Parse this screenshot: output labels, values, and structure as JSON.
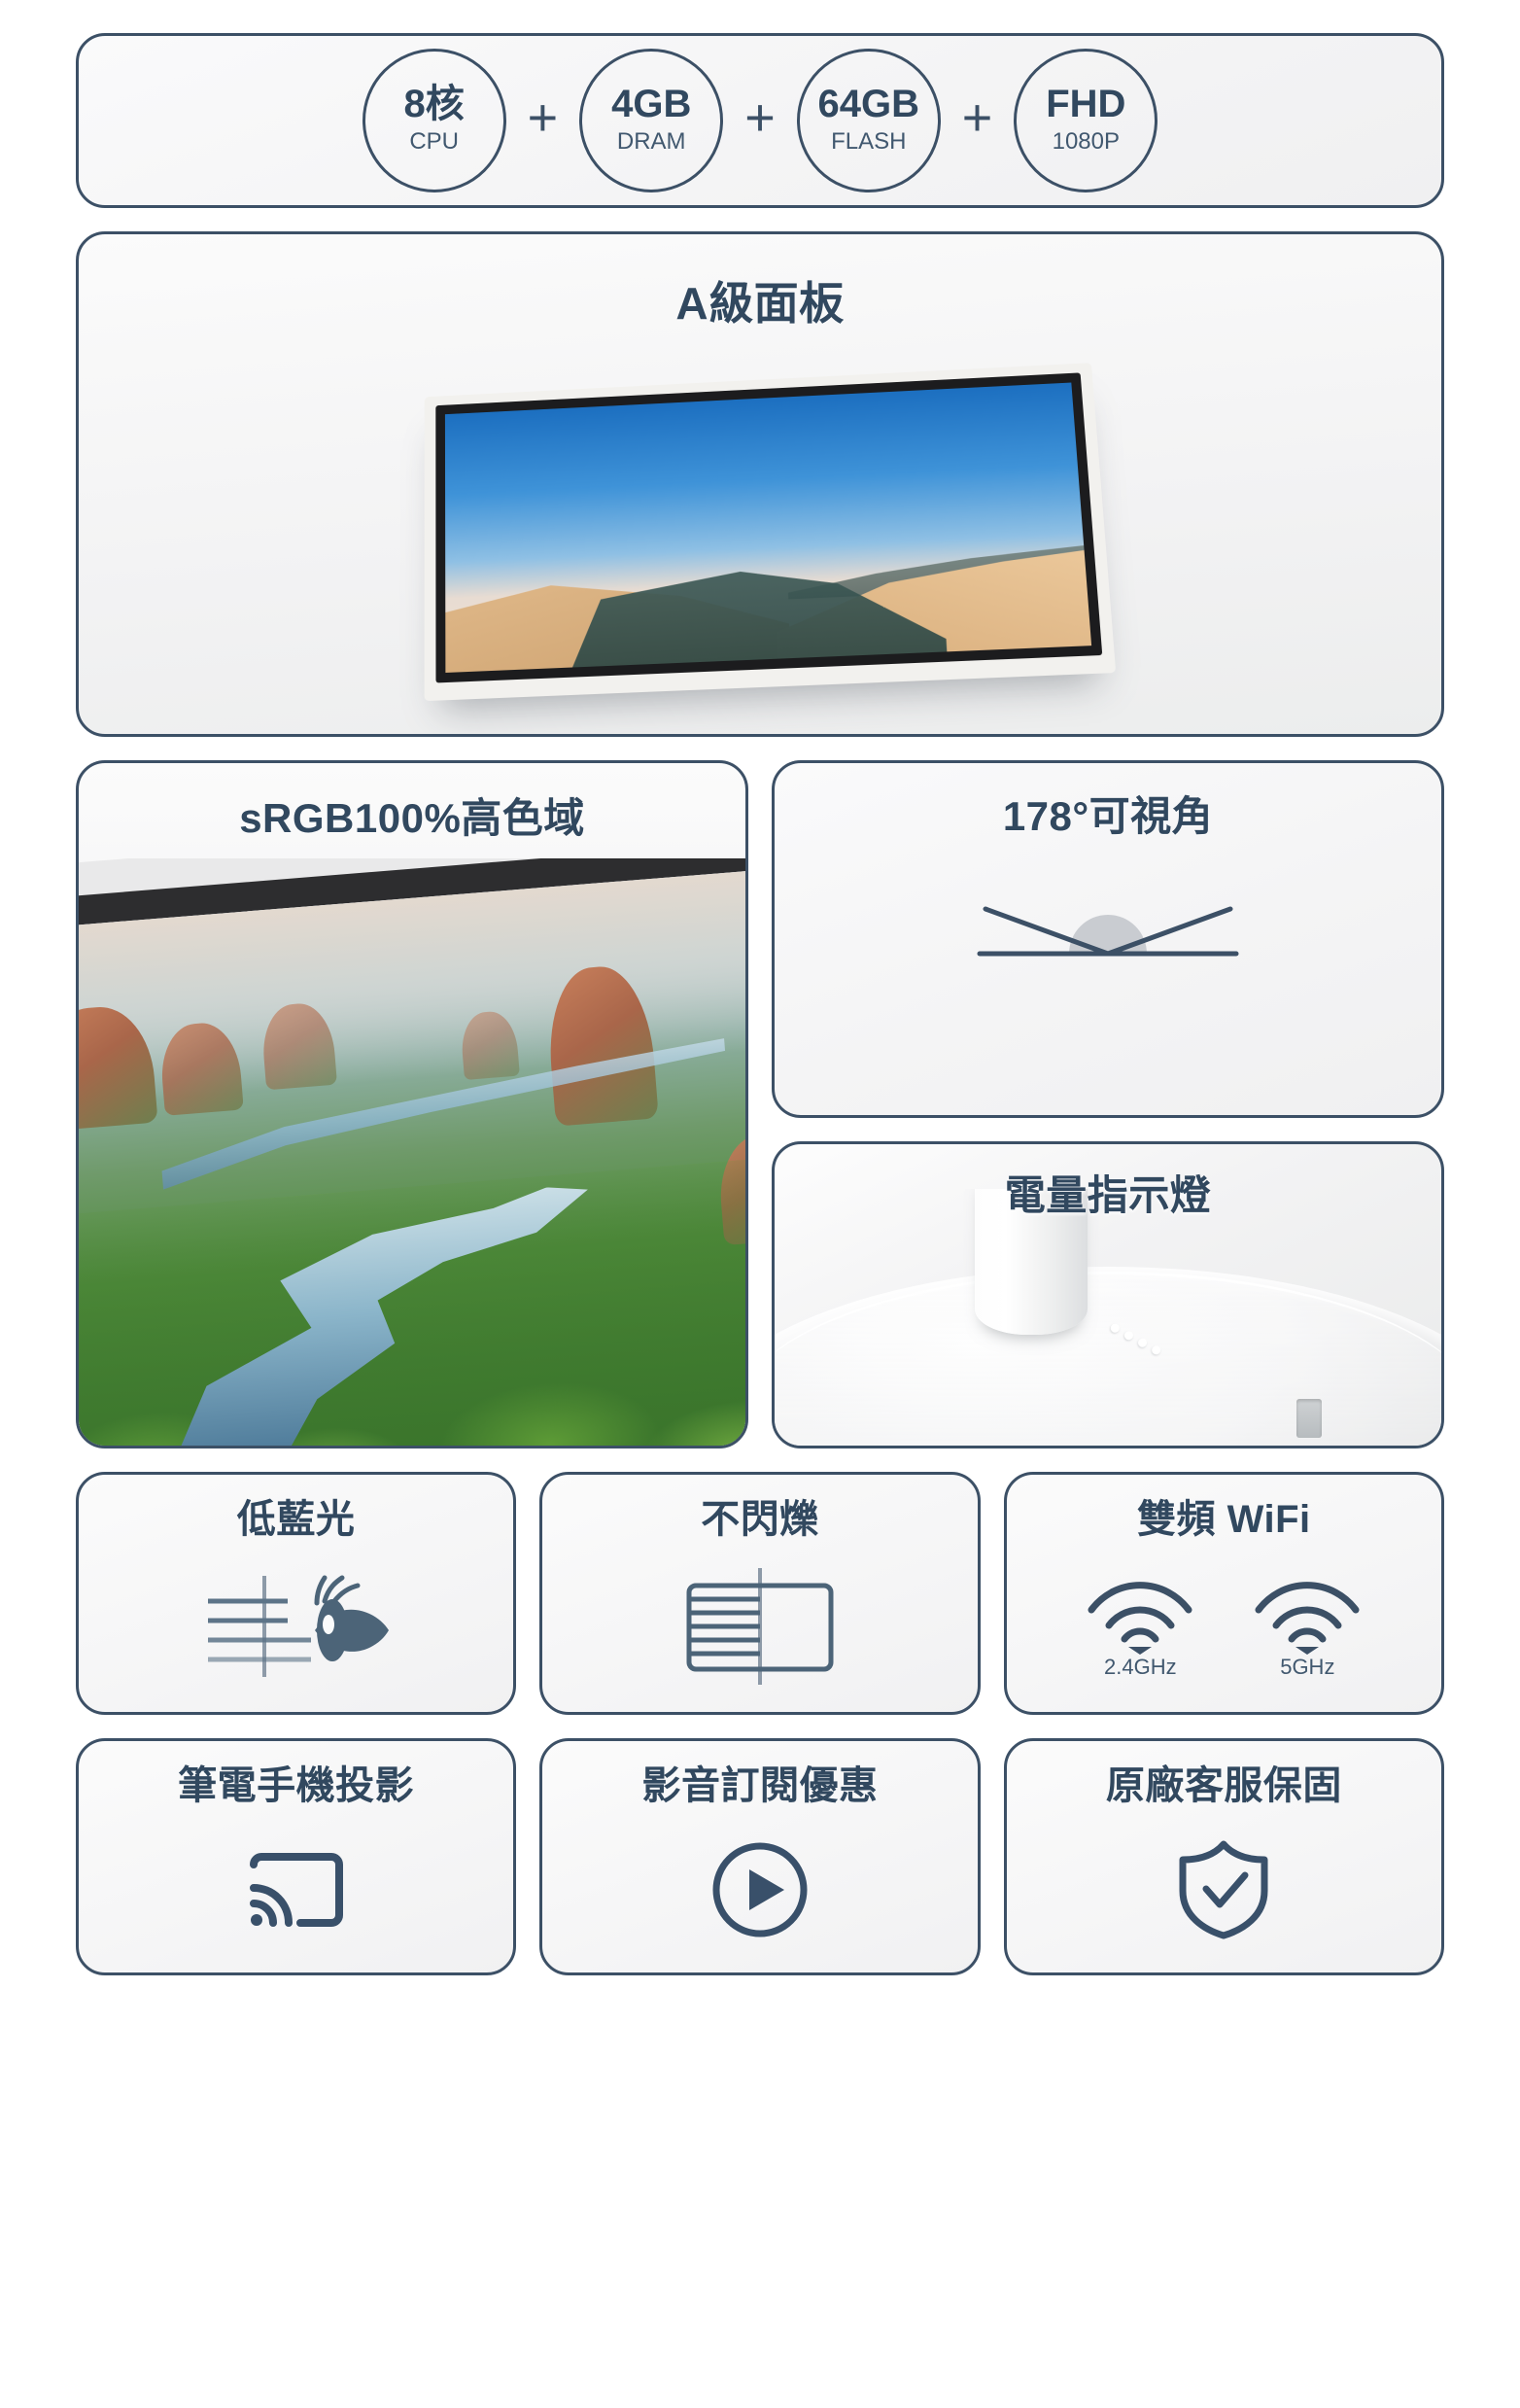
{
  "theme": {
    "ink": "#31485f",
    "border": "#3c5066",
    "card_bg": "#f4f4f5",
    "page_bg": "#ffffff"
  },
  "spec_strip": {
    "separator": "+",
    "items": [
      {
        "main": "8核",
        "sub": "CPU",
        "icon": "cpu-circle-icon"
      },
      {
        "main": "4GB",
        "sub": "DRAM",
        "icon": "dram-circle-icon"
      },
      {
        "main": "64GB",
        "sub": "FLASH",
        "icon": "flash-circle-icon"
      },
      {
        "main": "FHD",
        "sub": "1080P",
        "icon": "resolution-circle-icon"
      }
    ]
  },
  "panel_hero": {
    "title": "A級面板",
    "image_alt": "desert-dune-monitor-photo"
  },
  "mid": {
    "srgb": {
      "title": "sRGB100%高色域",
      "image_alt": "mangrove-river-monitor-photo"
    },
    "angle": {
      "title": "178°可視角",
      "icon": "viewing-angle-icon"
    },
    "battery": {
      "title": "電量指示燈",
      "image_alt": "monitor-base-led-photo"
    }
  },
  "features": [
    {
      "title": "低藍光",
      "icon": "low-blue-light-eye-icon"
    },
    {
      "title": "不閃爍",
      "icon": "flicker-free-screen-icon"
    },
    {
      "title": "雙頻 WiFi",
      "icon": "dual-band-wifi-icon",
      "bands": [
        {
          "label": "2.4GHz"
        },
        {
          "label": "5GHz"
        }
      ]
    }
  ],
  "bottom": [
    {
      "title": "筆電手機投影",
      "icon": "screen-cast-icon"
    },
    {
      "title": "影音訂閱優惠",
      "icon": "play-circle-icon"
    },
    {
      "title": "原廠客服保固",
      "icon": "shield-check-icon"
    }
  ]
}
